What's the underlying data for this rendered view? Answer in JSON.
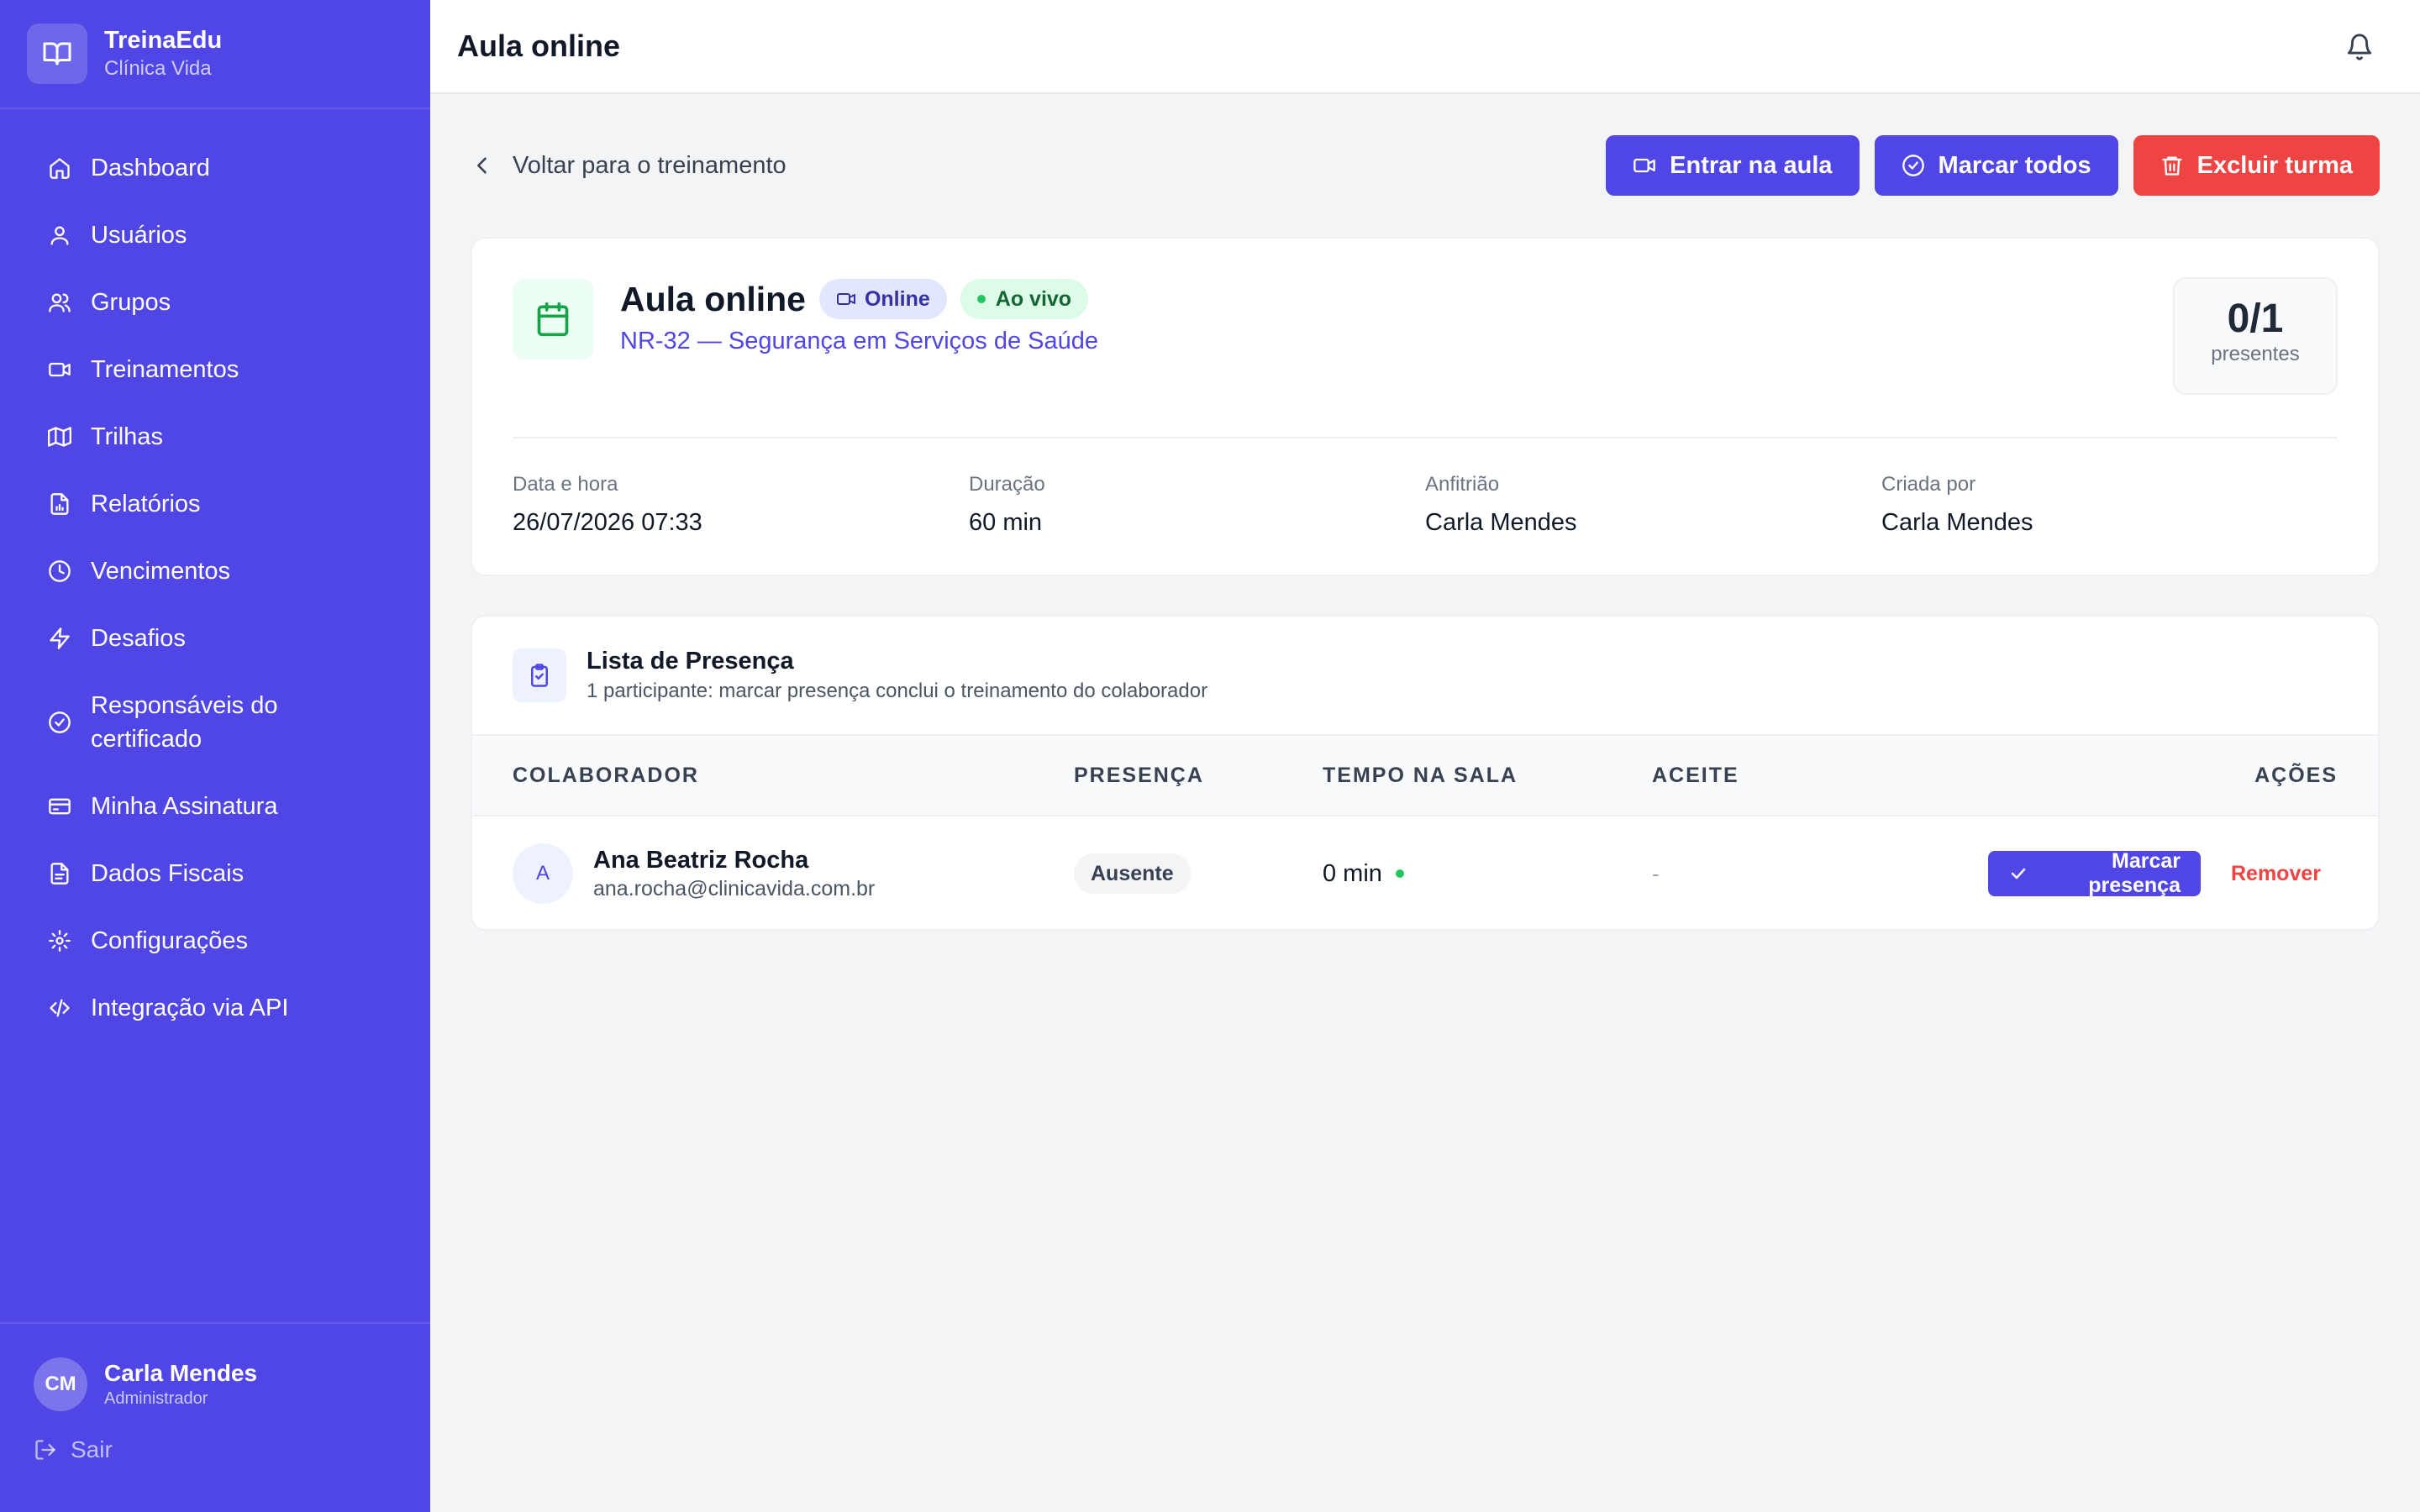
{
  "brand": {
    "name": "TreinaEdu",
    "subtitle": "Clínica Vida",
    "icon": "book-open-icon"
  },
  "sidebar": {
    "items": [
      {
        "label": "Dashboard",
        "icon": "home-icon"
      },
      {
        "label": "Usuários",
        "icon": "user-icon"
      },
      {
        "label": "Grupos",
        "icon": "users-icon"
      },
      {
        "label": "Treinamentos",
        "icon": "video-icon"
      },
      {
        "label": "Trilhas",
        "icon": "map-icon"
      },
      {
        "label": "Relatórios",
        "icon": "report-icon"
      },
      {
        "label": "Vencimentos",
        "icon": "clock-icon"
      },
      {
        "label": "Desafios",
        "icon": "zap-icon"
      },
      {
        "label": "Responsáveis do certificado",
        "icon": "check-circle-icon"
      },
      {
        "label": "Minha Assinatura",
        "icon": "credit-card-icon"
      },
      {
        "label": "Dados Fiscais",
        "icon": "file-icon"
      },
      {
        "label": "Configurações",
        "icon": "gear-icon"
      },
      {
        "label": "Integração via API",
        "icon": "code-icon"
      }
    ],
    "user": {
      "initials": "CM",
      "name": "Carla Mendes",
      "role": "Administrador"
    },
    "logout_label": "Sair"
  },
  "topbar": {
    "title": "Aula online",
    "bell_icon": "bell-icon"
  },
  "actions": {
    "back_label": "Voltar para o treinamento",
    "join_label": "Entrar na aula",
    "mark_all_label": "Marcar todos",
    "delete_label": "Excluir turma"
  },
  "session": {
    "title": "Aula online",
    "badge_online": "Online",
    "badge_live": "Ao vivo",
    "training": "NR-32 — Segurança em Serviços de Saúde",
    "count": "0/1",
    "count_label": "presentes",
    "meta": [
      {
        "key": "Data e hora",
        "value": "26/07/2026 07:33"
      },
      {
        "key": "Duração",
        "value": "60 min"
      },
      {
        "key": "Anfitrião",
        "value": "Carla Mendes"
      },
      {
        "key": "Criada por",
        "value": "Carla Mendes"
      }
    ]
  },
  "attendance": {
    "title": "Lista de Presença",
    "subtitle": "1 participante: marcar presença conclui o treinamento do colaborador",
    "columns": [
      "COLABORADOR",
      "PRESENÇA",
      "TEMPO NA SALA",
      "ACEITE",
      "AÇÕES"
    ],
    "rows": [
      {
        "initial": "A",
        "name": "Ana Beatriz Rocha",
        "email": "ana.rocha@clinicavida.com.br",
        "presence": "Ausente",
        "time": "0 min",
        "accept": "-",
        "mark_label": "Marcar presença",
        "remove_label": "Remover"
      }
    ]
  },
  "colors": {
    "primary": "#4f46e5",
    "danger": "#ef4444",
    "success": "#22c55e"
  }
}
